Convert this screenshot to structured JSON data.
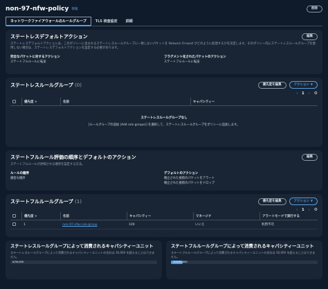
{
  "header": {
    "title": "non-97-nfw-policy",
    "info_link": "情報",
    "delete_label": "削除"
  },
  "tabs": [
    {
      "label": "ネットワークファイアウォールのルールグループ",
      "active": true
    },
    {
      "label": "TLS 検査設定",
      "active": false
    },
    {
      "label": "詳細",
      "active": false
    }
  ],
  "stateless_default": {
    "title": "ステートレスデフォルトアクション",
    "edit_label": "編集",
    "description": "ステートレスデフォルトアクションは、このポリシーに含まれるステートレスルールグループに一致しないパケットを Network Firewall がどのように処理するかを決定します。そのポリシー内にステートレスルールグループを使用しない場合は、ステートレスデフォルトアクションを設定する必要があります。",
    "full_label": "完全なパケットに対するアクション",
    "full_value": "ステートフルルールに転送",
    "frag_label": "フラグメント化されたパケットのアクション",
    "frag_value": "ステートフルルールに転送"
  },
  "stateless_groups": {
    "title": "ステートレスルールグループ",
    "count": "(0)",
    "priority_edit_label": "優先度を編集",
    "action_label": "アクション",
    "page": "1",
    "columns": [
      "優先度",
      "名前",
      "キャパシティー"
    ],
    "empty_title": "ステートレスルールグループなし",
    "empty_text": "[ルールグループの追加 (Add rule groups)] を選択して、ステートレスルールグループをポリシーに追加します。"
  },
  "stateful_order": {
    "title": "ステートフルルール評価の順序とデフォルトのアクション",
    "edit_label": "編集",
    "description": "ステートフルルールが評価される順序を設定する方法。",
    "order_label": "ルールの順序",
    "order_value": "厳密な順序",
    "default_label": "デフォルトのアクション",
    "default_values": [
      "確立された接続のパケットをアラート",
      "確立された接続のパケットをドロップ"
    ]
  },
  "stateful_groups": {
    "title": "ステートフルルールグループ",
    "count": "(1)",
    "priority_edit_label": "優先度を編集",
    "action_label": "アクション",
    "page": "1",
    "columns": [
      "優先度",
      "名前",
      "キャパシティー",
      "マネージド",
      "アラートモードで実行する"
    ],
    "rows": [
      {
        "priority": "1",
        "name": "non-97-nfw-rule-group",
        "capacity": "100",
        "managed": "いいえ",
        "alert_mode": "利用不可"
      }
    ]
  },
  "capacity_cards": [
    {
      "title": "ステートレスルールグループによって消費されるキャパシティーユニット",
      "desc": "ステートレスルールグループによって消費されるキャパシティーユニットの合計は 30,000 を超えることはできません。",
      "meter_label": "0/30,000",
      "used": 0,
      "max": 30000
    },
    {
      "title": "ステートフルルールグループによって消費されるキャパシティーユニット",
      "desc": "ステートフルルールグループによって消費されるキャパシティーユニットの合計は 30,000 を超えることはできません。",
      "meter_label": "100/30,000",
      "used": 100,
      "max": 30000
    }
  ],
  "colors": {
    "accent": "#539fe5",
    "panel": "#192534",
    "background": "#0f1b2a"
  }
}
